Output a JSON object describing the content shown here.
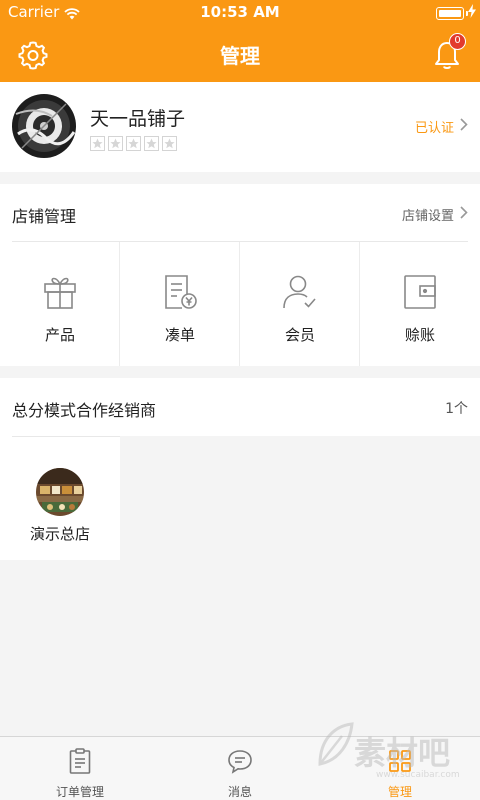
{
  "status_bar": {
    "carrier": "Carrier",
    "time": "10:53 AM",
    "battery_level": 1.0
  },
  "nav": {
    "title": "管理",
    "settings_icon": "gear-icon",
    "bell_icon": "bell-icon",
    "badge_count": "0"
  },
  "profile": {
    "shop_name": "天一品铺子",
    "rating_stars": 5,
    "rating_value": 0,
    "verified_label": "已认证"
  },
  "store_management": {
    "title": "店铺管理",
    "settings_link": "店铺设置",
    "items": [
      {
        "label": "产品",
        "icon": "gift-box-icon"
      },
      {
        "label": "凑单",
        "icon": "receipt-yen-icon"
      },
      {
        "label": "会员",
        "icon": "member-icon"
      },
      {
        "label": "赊账",
        "icon": "wallet-icon"
      }
    ]
  },
  "distributors": {
    "title": "总分模式合作经销商",
    "count": "1个",
    "items": [
      {
        "label": "演示总店",
        "icon": "store-photo-icon"
      }
    ]
  },
  "tabbar": {
    "tabs": [
      {
        "label": "订单管理",
        "icon": "clipboard-icon",
        "active": false
      },
      {
        "label": "消息",
        "icon": "chat-bubble-icon",
        "active": false
      },
      {
        "label": "管理",
        "icon": "manage-grid-icon",
        "active": true
      }
    ]
  },
  "watermark": {
    "text": "素材吧",
    "url": "www.sucaibar.com"
  },
  "colors": {
    "accent": "#fa9813",
    "badge": "#e23b2d",
    "background": "#f4f4f4"
  }
}
